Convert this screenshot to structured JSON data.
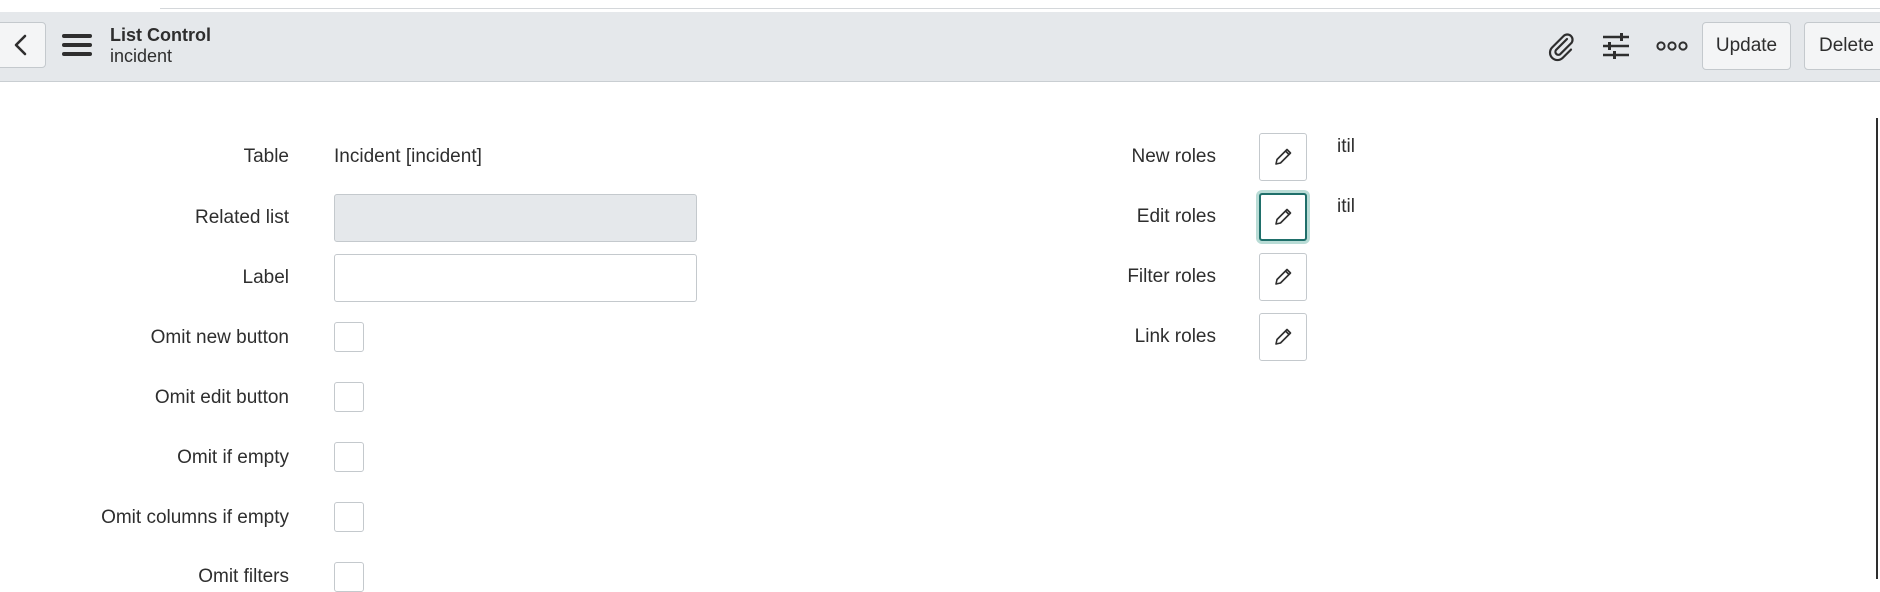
{
  "header": {
    "title": "List Control",
    "subtitle": "incident",
    "update_label": "Update",
    "delete_label": "Delete"
  },
  "form": {
    "table_label": "Table",
    "table_value": "Incident [incident]",
    "related_list_label": "Related list",
    "related_list_value": "",
    "label_label": "Label",
    "label_value": "",
    "omit_new_button_label": "Omit new button",
    "omit_edit_button_label": "Omit edit button",
    "omit_if_empty_label": "Omit if empty",
    "omit_columns_if_empty_label": "Omit columns if empty",
    "omit_filters_label": "Omit filters"
  },
  "roles": {
    "new_roles_label": "New roles",
    "new_roles_value": "itil",
    "edit_roles_label": "Edit roles",
    "edit_roles_value": "itil",
    "filter_roles_label": "Filter roles",
    "link_roles_label": "Link roles"
  },
  "colors": {
    "header_bg": "#e5e8eb",
    "focus_ring": "#1f6f6a"
  },
  "icons": {
    "back": "chevron-left-icon",
    "menu": "hamburger-menu-icon",
    "attachment": "paperclip-icon",
    "personalize": "sliders-icon",
    "more": "more-options-icon",
    "edit": "pencil-icon"
  }
}
